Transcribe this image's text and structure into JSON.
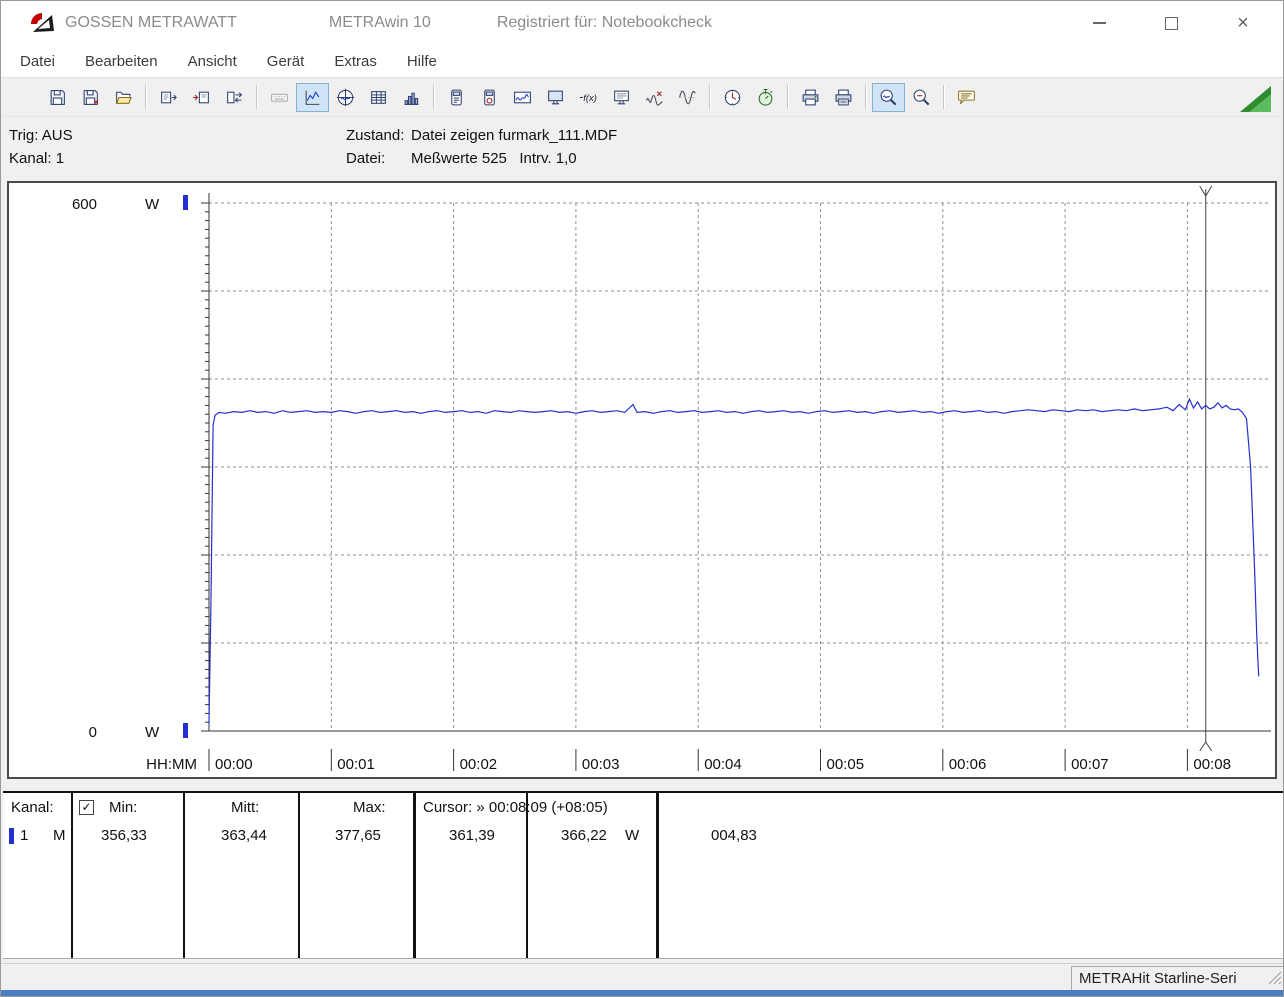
{
  "window": {
    "brand": "GOSSEN METRAWATT",
    "title": "METRAwin 10",
    "registered": "Registriert für: Notebookcheck"
  },
  "menu": {
    "items": [
      "Datei",
      "Bearbeiten",
      "Ansicht",
      "Gerät",
      "Extras",
      "Hilfe"
    ]
  },
  "toolbar": {
    "groups": [
      [
        "save-icon",
        "save-setup-icon",
        "open-file-icon"
      ],
      [
        "export-device-icon",
        "import-device-icon",
        "transfer-icon"
      ],
      [
        "keyboard-icon",
        "line-chart-view-icon",
        "scope-view-icon",
        "table-view-icon",
        "bar-chart-view-icon"
      ],
      [
        "device-a-icon",
        "device-b-icon",
        "display-waveform-icon",
        "monitor-icon",
        "formula-icon",
        "monitor-report-icon",
        "waveform-x-icon",
        "waveform-sine-icon"
      ],
      [
        "clock-icon",
        "stopwatch-icon"
      ],
      [
        "print-icon",
        "print-preview-icon"
      ],
      [
        "zoom-waveform-icon",
        "zoom-out-icon"
      ],
      [
        "comment-icon"
      ]
    ],
    "pressed": [
      "line-chart-view-icon",
      "zoom-waveform-icon"
    ],
    "disabled": [
      "keyboard-icon"
    ]
  },
  "status_panel": {
    "trig": "Trig: AUS",
    "kanal": "Kanal: 1",
    "zustand_label": "Zustand:",
    "zustand_value": "Datei zeigen furmark_111.MDF",
    "datei_label": "Datei:",
    "datei_value": "Meßwerte 525   Intrv. 1,0"
  },
  "chart_data": {
    "type": "line",
    "title": "",
    "unit": "W",
    "ylim": [
      0,
      600
    ],
    "grid": true,
    "x_axis_label": "HH:MM",
    "x_ticks": [
      "00:00",
      "00:01",
      "00:02",
      "00:03",
      "00:04",
      "00:05",
      "00:06",
      "00:07",
      "00:08"
    ],
    "sample_interval_seconds": 1,
    "cursor_seconds": 489,
    "cursor_label": "00:08:09",
    "series": [
      {
        "name": "Kanal 1 (M)",
        "color": "#2330cf",
        "points": [
          [
            0,
            8
          ],
          [
            1,
            150
          ],
          [
            2,
            348
          ],
          [
            3,
            359
          ],
          [
            5,
            362
          ],
          [
            8,
            361
          ],
          [
            12,
            363
          ],
          [
            16,
            362
          ],
          [
            20,
            364
          ],
          [
            24,
            362
          ],
          [
            28,
            363
          ],
          [
            32,
            361
          ],
          [
            36,
            364
          ],
          [
            40,
            362
          ],
          [
            44,
            363
          ],
          [
            48,
            364
          ],
          [
            52,
            362
          ],
          [
            56,
            363
          ],
          [
            60,
            362
          ],
          [
            64,
            364
          ],
          [
            68,
            363
          ],
          [
            72,
            361
          ],
          [
            76,
            363
          ],
          [
            80,
            364
          ],
          [
            84,
            362
          ],
          [
            88,
            363
          ],
          [
            92,
            364
          ],
          [
            96,
            362
          ],
          [
            100,
            363
          ],
          [
            104,
            361
          ],
          [
            108,
            363
          ],
          [
            112,
            364
          ],
          [
            116,
            362
          ],
          [
            120,
            363
          ],
          [
            124,
            364
          ],
          [
            128,
            362
          ],
          [
            132,
            363
          ],
          [
            136,
            361
          ],
          [
            140,
            364
          ],
          [
            144,
            363
          ],
          [
            148,
            362
          ],
          [
            152,
            364
          ],
          [
            156,
            363
          ],
          [
            160,
            362
          ],
          [
            164,
            363
          ],
          [
            168,
            364
          ],
          [
            172,
            362
          ],
          [
            176,
            363
          ],
          [
            180,
            361
          ],
          [
            184,
            363
          ],
          [
            188,
            364
          ],
          [
            192,
            362
          ],
          [
            196,
            363
          ],
          [
            200,
            364
          ],
          [
            204,
            362
          ],
          [
            208,
            371
          ],
          [
            210,
            362
          ],
          [
            214,
            363
          ],
          [
            218,
            361
          ],
          [
            222,
            363
          ],
          [
            226,
            364
          ],
          [
            230,
            362
          ],
          [
            234,
            363
          ],
          [
            238,
            364
          ],
          [
            242,
            362
          ],
          [
            246,
            363
          ],
          [
            250,
            364
          ],
          [
            254,
            362
          ],
          [
            258,
            363
          ],
          [
            262,
            361
          ],
          [
            266,
            363
          ],
          [
            270,
            364
          ],
          [
            274,
            362
          ],
          [
            278,
            363
          ],
          [
            282,
            364
          ],
          [
            286,
            362
          ],
          [
            290,
            363
          ],
          [
            294,
            361
          ],
          [
            298,
            363
          ],
          [
            302,
            364
          ],
          [
            306,
            362
          ],
          [
            310,
            363
          ],
          [
            314,
            364
          ],
          [
            318,
            362
          ],
          [
            322,
            363
          ],
          [
            326,
            361
          ],
          [
            330,
            363
          ],
          [
            334,
            364
          ],
          [
            338,
            362
          ],
          [
            342,
            363
          ],
          [
            346,
            364
          ],
          [
            350,
            362
          ],
          [
            354,
            363
          ],
          [
            358,
            361
          ],
          [
            362,
            363
          ],
          [
            366,
            364
          ],
          [
            370,
            362
          ],
          [
            374,
            363
          ],
          [
            378,
            364
          ],
          [
            382,
            362
          ],
          [
            386,
            363
          ],
          [
            390,
            361
          ],
          [
            394,
            363
          ],
          [
            398,
            364
          ],
          [
            402,
            365
          ],
          [
            406,
            364
          ],
          [
            410,
            363
          ],
          [
            414,
            365
          ],
          [
            418,
            364
          ],
          [
            422,
            363
          ],
          [
            426,
            365
          ],
          [
            430,
            364
          ],
          [
            434,
            365
          ],
          [
            438,
            363
          ],
          [
            442,
            364
          ],
          [
            446,
            365
          ],
          [
            450,
            364
          ],
          [
            454,
            366
          ],
          [
            458,
            364
          ],
          [
            462,
            365
          ],
          [
            466,
            366
          ],
          [
            470,
            368
          ],
          [
            473,
            364
          ],
          [
            476,
            371
          ],
          [
            479,
            365
          ],
          [
            481,
            377
          ],
          [
            483,
            367
          ],
          [
            485,
            374
          ],
          [
            487,
            366
          ],
          [
            489,
            370
          ],
          [
            491,
            366
          ],
          [
            493,
            368
          ],
          [
            495,
            373
          ],
          [
            497,
            367
          ],
          [
            499,
            370
          ],
          [
            501,
            366
          ],
          [
            503,
            365
          ],
          [
            505,
            366
          ],
          [
            507,
            362
          ],
          [
            509,
            355
          ],
          [
            511,
            300
          ],
          [
            513,
            180
          ],
          [
            514,
            110
          ],
          [
            515,
            62
          ]
        ]
      }
    ],
    "stats": {
      "min": 356.33,
      "mean": 363.44,
      "max": 377.65,
      "cursor1": 361.39,
      "cursor2": 366.22,
      "delta": 4.83
    }
  },
  "table": {
    "header": {
      "kanal": "Kanal:",
      "checkbox_checked": true,
      "min": "Min:",
      "mitt": "Mitt:",
      "max": "Max:",
      "cursor": "Cursor: » 00:08:09 (+08:05)"
    },
    "row": {
      "channel": "1",
      "mode": "M",
      "min": "356,33",
      "mitt": "363,44",
      "max": "377,65",
      "cursor1": "361,39",
      "cursor2": "366,22",
      "unit": "W",
      "delta": "004,83"
    }
  },
  "statusbar": {
    "device": "METRAHit Starline-Seri"
  }
}
